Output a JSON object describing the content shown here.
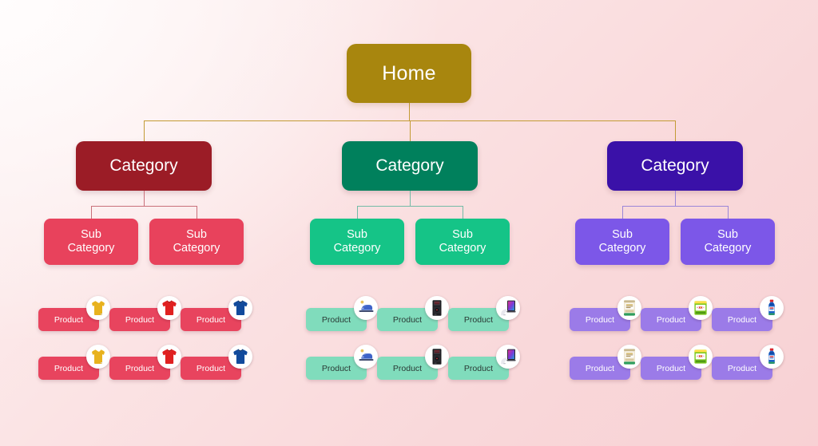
{
  "diagram": {
    "title": "Ecommerce site hierarchy tree",
    "type": "tree",
    "background": {
      "from": "#fffdfd",
      "to": "#f8d1d4"
    },
    "root": {
      "label": "Home",
      "color": "#A8860E",
      "text_color": "#ffffff",
      "connector_color": "#C39B35"
    },
    "branches": [
      {
        "id": "branch-1",
        "category": {
          "label": "Category",
          "color": "#9B1C26",
          "text_color": "#ffffff",
          "connector_color": "#C9707A"
        },
        "subcategories": [
          {
            "line1": "Sub",
            "line2": "Category",
            "color": "#E8425C",
            "text_color": "#ffffff"
          },
          {
            "line1": "Sub",
            "line2": "Category",
            "color": "#E8425C",
            "text_color": "#ffffff"
          }
        ],
        "product_style": {
          "color": "#E8445E",
          "text_color": "#ffffff"
        },
        "products": [
          {
            "label": "Product",
            "icon": "yellow-polo-shirt-icon"
          },
          {
            "label": "Product",
            "icon": "red-tshirt-icon"
          },
          {
            "label": "Product",
            "icon": "blue-tshirt-icon"
          },
          {
            "label": "Product",
            "icon": "yellow-polo-shirt-icon"
          },
          {
            "label": "Product",
            "icon": "red-tshirt-icon"
          },
          {
            "label": "Product",
            "icon": "blue-tshirt-icon"
          }
        ]
      },
      {
        "id": "branch-2",
        "category": {
          "label": "Category",
          "color": "#00805C",
          "text_color": "#ffffff",
          "connector_color": "#74BBA6"
        },
        "subcategories": [
          {
            "line1": "Sub",
            "line2": "Category",
            "color": "#15C487",
            "text_color": "#ffffff"
          },
          {
            "line1": "Sub",
            "line2": "Category",
            "color": "#15C487",
            "text_color": "#ffffff"
          }
        ],
        "product_style": {
          "color": "#80DCBC",
          "text_color": "#2A3A35"
        },
        "products": [
          {
            "label": "Product",
            "icon": "clothes-iron-icon"
          },
          {
            "label": "Product",
            "icon": "black-pc-tower-icon"
          },
          {
            "label": "Product",
            "icon": "laptop-device-icon"
          },
          {
            "label": "Product",
            "icon": "clothes-iron-icon"
          },
          {
            "label": "Product",
            "icon": "black-pc-tower-icon"
          },
          {
            "label": "Product",
            "icon": "laptop-device-icon"
          }
        ]
      },
      {
        "id": "branch-3",
        "category": {
          "label": "Category",
          "color": "#3A11A8",
          "text_color": "#ffffff",
          "connector_color": "#9B86D8"
        },
        "subcategories": [
          {
            "line1": "Sub",
            "line2": "Category",
            "color": "#7C57E8",
            "text_color": "#ffffff"
          },
          {
            "line1": "Sub",
            "line2": "Category",
            "color": "#7C57E8",
            "text_color": "#ffffff"
          }
        ],
        "product_style": {
          "color": "#9B7BE8",
          "text_color": "#ffffff"
        },
        "products": [
          {
            "label": "Product",
            "icon": "snack-bag-package-icon"
          },
          {
            "label": "Product",
            "icon": "green-food-package-icon"
          },
          {
            "label": "Product",
            "icon": "blue-detergent-bottle-icon"
          },
          {
            "label": "Product",
            "icon": "snack-bag-package-icon"
          },
          {
            "label": "Product",
            "icon": "green-food-package-icon"
          },
          {
            "label": "Product",
            "icon": "blue-detergent-bottle-icon"
          }
        ]
      }
    ]
  }
}
